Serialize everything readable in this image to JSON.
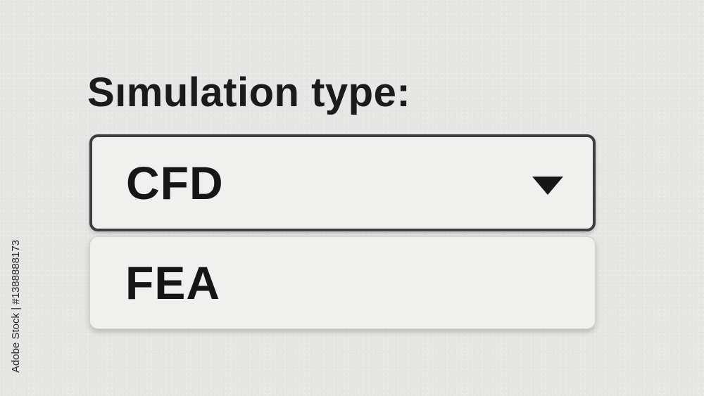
{
  "field": {
    "label": "Sımulation type:"
  },
  "select": {
    "selected_value": "CFD",
    "options": [
      "FEA"
    ]
  },
  "icons": {
    "dropdown": "triangle-down-icon"
  },
  "watermark": {
    "text": "Adobe Stock | #1388888173"
  }
}
